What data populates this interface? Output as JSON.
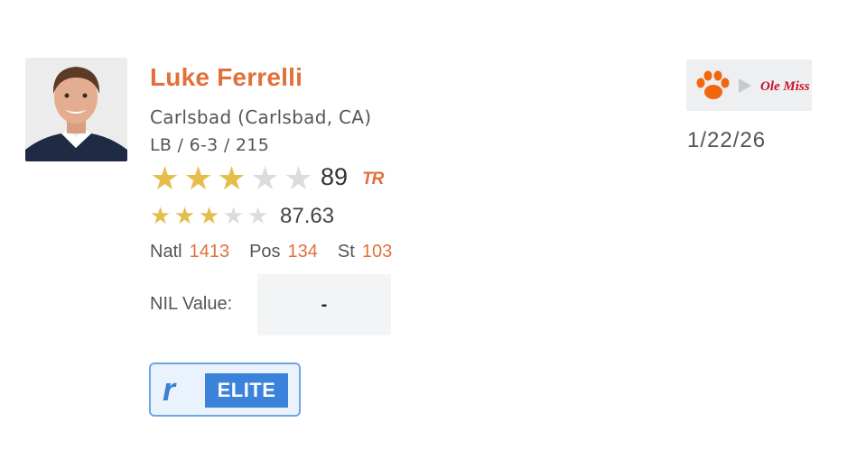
{
  "player": {
    "name": "Luke Ferrelli",
    "hometown": "Carlsbad (Carlsbad, CA)",
    "measurables": "LB / 6-3 / 215"
  },
  "ratings": {
    "primary": {
      "stars_filled": 3,
      "stars_total": 5,
      "score": "89",
      "logo_text": "TR"
    },
    "secondary": {
      "stars_filled": 3,
      "stars_total": 5,
      "score": "87.63"
    }
  },
  "ranks": [
    {
      "label": "Natl",
      "value": "1413"
    },
    {
      "label": "Pos",
      "value": "134"
    },
    {
      "label": "St",
      "value": "103"
    }
  ],
  "nil": {
    "label": "NIL Value:",
    "value": "-"
  },
  "badge": {
    "logo": "r",
    "label": "ELITE"
  },
  "transfer": {
    "from_icon": "paw-icon",
    "to_logo_text": "Ole Miss",
    "date": "1/22/26"
  },
  "colors": {
    "accent": "#e2703a",
    "star_filled": "#e5bd4a",
    "star_empty": "#dcdcdc",
    "elite_blue": "#3b82db",
    "clemson_orange": "#f2660d",
    "olemiss_red": "#c8102e"
  }
}
